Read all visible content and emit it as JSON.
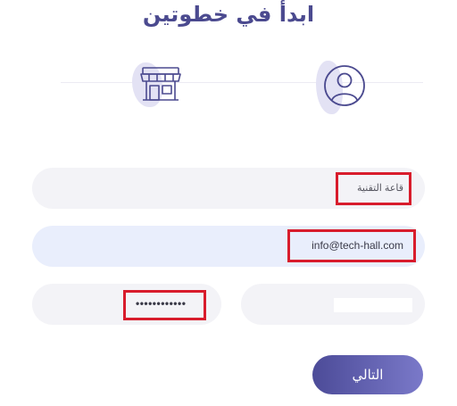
{
  "page": {
    "title": "ابدأ في خطوتين",
    "accent_color": "#4b4a8f",
    "highlight_color": "#d81c2c"
  },
  "stepper": {
    "steps": [
      {
        "icon": "store-icon"
      },
      {
        "icon": "user-icon"
      }
    ]
  },
  "form": {
    "company_name_value": "قاعة التقنية",
    "email_value": "info@tech-hall.com",
    "password_value": "••••••••••••",
    "next_label": "التالي"
  }
}
